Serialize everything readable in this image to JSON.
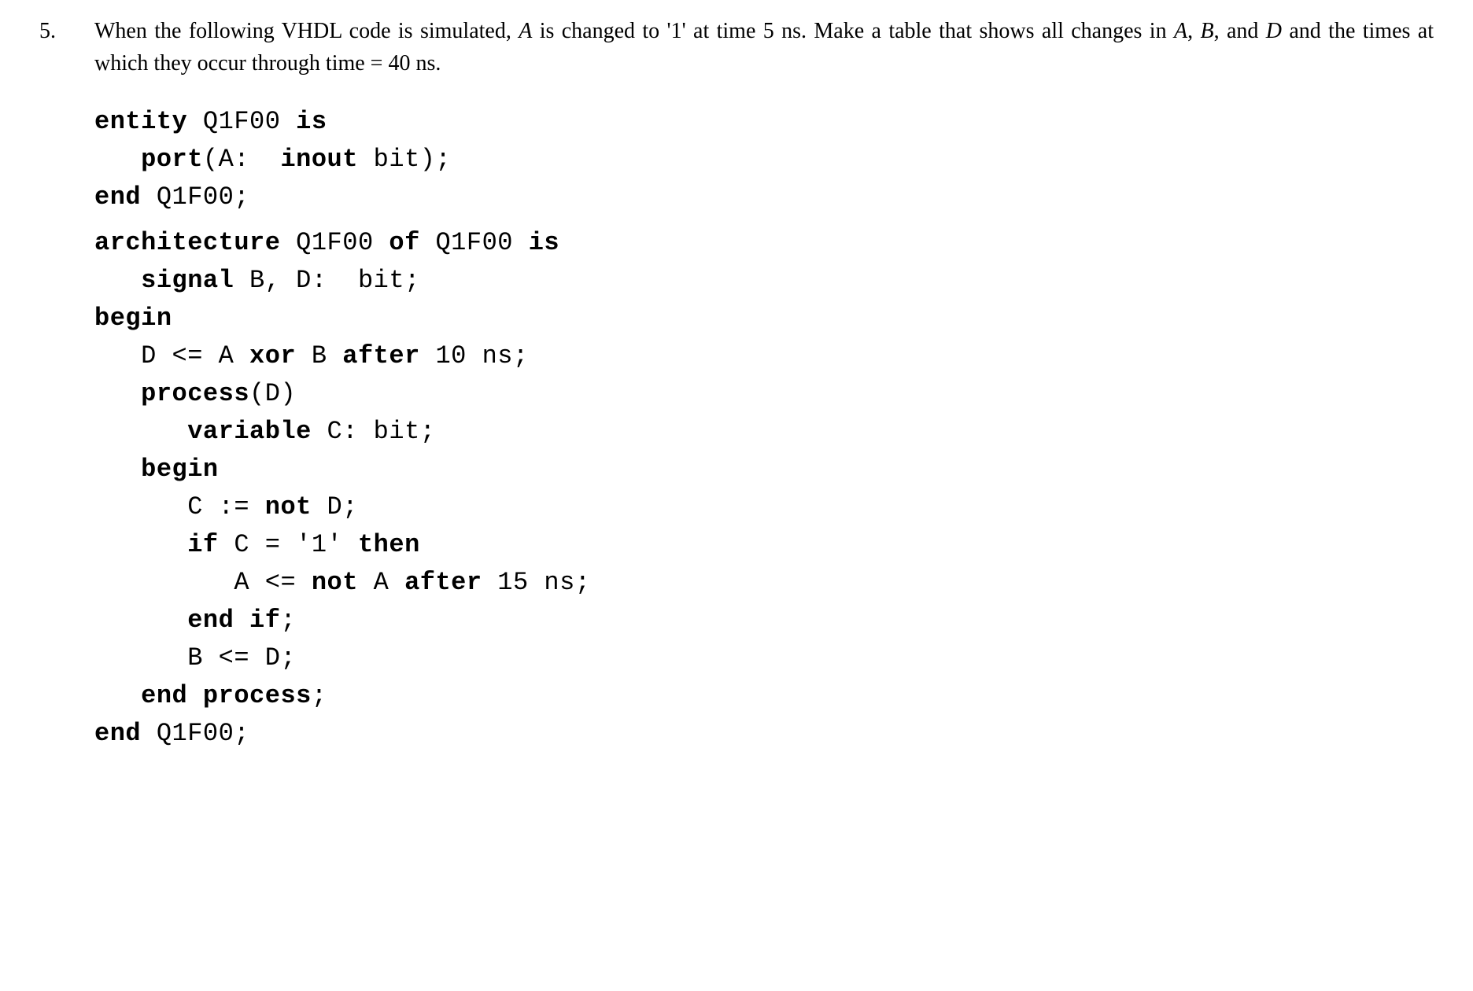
{
  "problem_number": "5.",
  "problem_text_html": "When the following VHDL code is simulated, <em>A</em> is changed to '1' at time 5 ns. Make a table that shows all changes in <em>A</em>, <em>B</em>, and <em>D</em> and the times at which they occur through time = 40 ns.",
  "code_lines": [
    {
      "indent": 0,
      "html": "<strong>entity</strong> Q1F00 <strong>is</strong>"
    },
    {
      "indent": 1,
      "html": "<strong>port</strong>(A:  <strong>inout</strong> bit);"
    },
    {
      "indent": 0,
      "html": "<strong>end</strong> Q1F00;"
    },
    {
      "indent": 0,
      "html": "&nbsp;",
      "gap": true
    },
    {
      "indent": 0,
      "html": "<strong>architecture</strong> Q1F00 <strong>of</strong> Q1F00 <strong>is</strong>"
    },
    {
      "indent": 1,
      "html": "<strong>signal</strong> B, D:  bit;"
    },
    {
      "indent": 0,
      "html": "<strong>begin</strong>"
    },
    {
      "indent": 1,
      "html": "D &lt;= A <strong>xor</strong> B <strong>after</strong> 10 ns;"
    },
    {
      "indent": 1,
      "html": "<strong>process</strong>(D)"
    },
    {
      "indent": 2,
      "html": "<strong>variable</strong> C: bit;"
    },
    {
      "indent": 1,
      "html": "<strong>begin</strong>"
    },
    {
      "indent": 2,
      "html": "C := <strong>not</strong> D;"
    },
    {
      "indent": 2,
      "html": "<strong>if</strong> C = '1' <strong>then</strong>"
    },
    {
      "indent": 3,
      "html": "A &lt;= <strong>not</strong> A <strong>after</strong> 15 ns;"
    },
    {
      "indent": 2,
      "html": "<strong>end if</strong>;"
    },
    {
      "indent": 2,
      "html": "B &lt;= D;"
    },
    {
      "indent": 1,
      "html": "<strong>end process</strong>;"
    },
    {
      "indent": 0,
      "html": "<strong>end</strong> Q1F00;"
    }
  ],
  "indent_unit": "   "
}
